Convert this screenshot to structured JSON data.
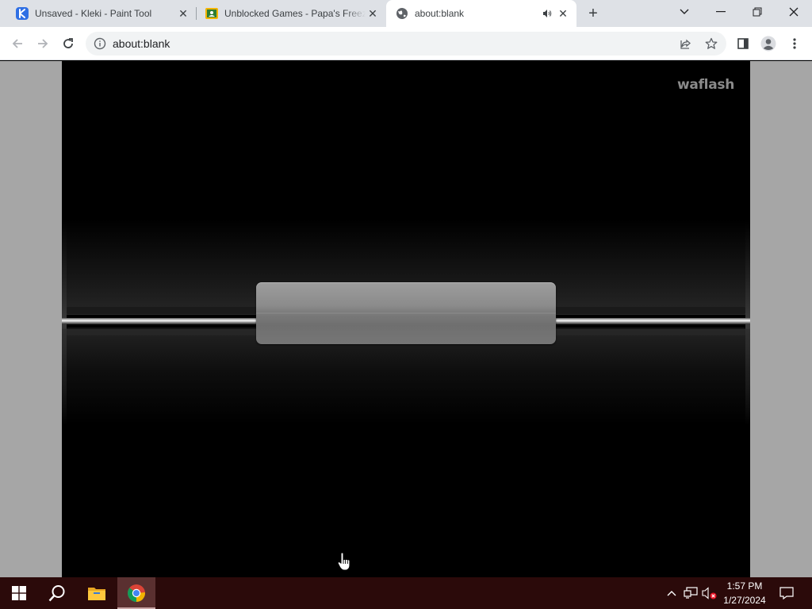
{
  "browser": {
    "tabs": [
      {
        "title": "Unsaved - Kleki - Paint Tool",
        "favicon": "kleki-icon",
        "active": false
      },
      {
        "title": "Unblocked Games - Papa's Freezeria",
        "favicon": "games-icon",
        "active": false
      },
      {
        "title": "about:blank",
        "favicon": "globe-icon",
        "active": true,
        "audio": true
      }
    ],
    "new_tab_label": "+",
    "url": "about:blank"
  },
  "page": {
    "watermark": "waflash"
  },
  "taskbar": {
    "time": "1:57 PM",
    "date": "1/27/2024"
  },
  "colors": {
    "tabstrip": "#dee1e6",
    "taskbar": "#2b0a0a",
    "game_background": "#000000",
    "plate": "#8b8b8b"
  }
}
